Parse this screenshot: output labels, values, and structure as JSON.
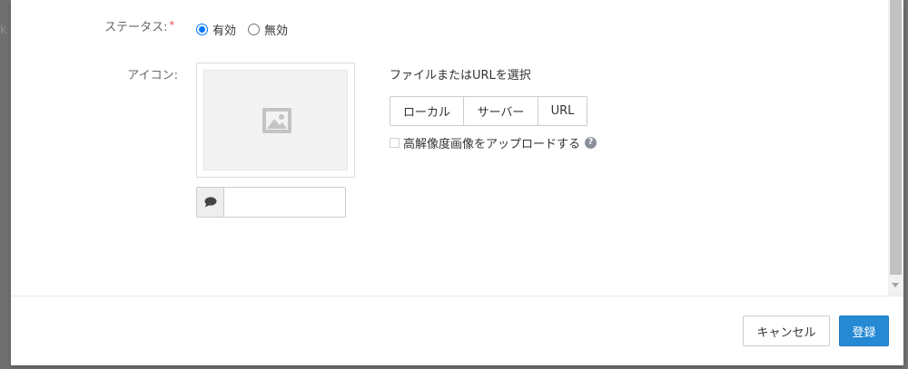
{
  "background": {
    "edge_glyph": "k"
  },
  "form": {
    "status": {
      "label": "ステータス:",
      "required_mark": "*",
      "options": [
        {
          "label": "有効",
          "checked": true
        },
        {
          "label": "無効",
          "checked": false
        }
      ]
    },
    "icon": {
      "label": "アイコン:",
      "preview_icon": "image-placeholder-icon",
      "caption_icon": "comment-icon",
      "caption_value": "",
      "select_title": "ファイルまたはURLを選択",
      "source_buttons": [
        "ローカル",
        "サーバー",
        "URL"
      ],
      "hires_label": "高解像度画像をアップロードする",
      "hires_checked": false,
      "help_icon": "question-circle-icon",
      "help_glyph": "?"
    }
  },
  "footer": {
    "cancel_label": "キャンセル",
    "submit_label": "登録"
  },
  "colors": {
    "primary": "#2689d4",
    "radio_accent": "#0075ff",
    "required": "#e4393c",
    "overlay": "#707070"
  }
}
